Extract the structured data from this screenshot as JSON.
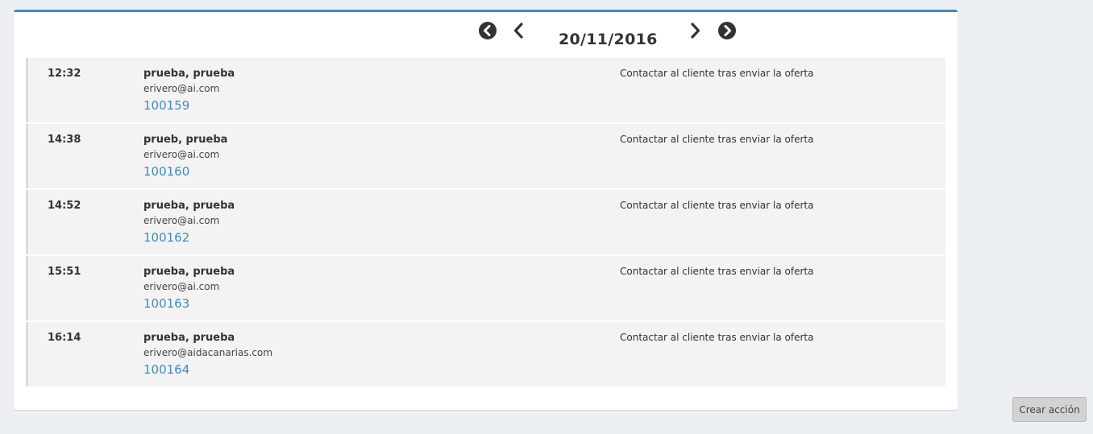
{
  "date_nav": {
    "date": "20/11/2016",
    "icons": {
      "first": "circle-chevron-left-icon",
      "prev": "chevron-left-icon",
      "next": "chevron-right-icon",
      "last": "circle-chevron-right-icon"
    }
  },
  "entries": [
    {
      "time": "12:32",
      "name": "prueba, prueba",
      "email": "erivero@ai.com",
      "ref": "100159",
      "action": "Contactar al cliente tras enviar la oferta"
    },
    {
      "time": "14:38",
      "name": "prueb, prueba",
      "email": "erivero@ai.com",
      "ref": "100160",
      "action": "Contactar al cliente tras enviar la oferta"
    },
    {
      "time": "14:52",
      "name": "prueba, prueba",
      "email": "erivero@ai.com",
      "ref": "100162",
      "action": "Contactar al cliente tras enviar la oferta"
    },
    {
      "time": "15:51",
      "name": "prueba, prueba",
      "email": "erivero@ai.com",
      "ref": "100163",
      "action": "Contactar al cliente tras enviar la oferta"
    },
    {
      "time": "16:14",
      "name": "prueba, prueba",
      "email": "erivero@aidacanarias.com",
      "ref": "100164",
      "action": "Contactar al cliente tras enviar la oferta"
    }
  ],
  "footer": {
    "create_button": "Crear acción"
  },
  "colors": {
    "accent": "#3c8dbc",
    "background": "#eceff3",
    "row_background": "#f3f3f3"
  }
}
